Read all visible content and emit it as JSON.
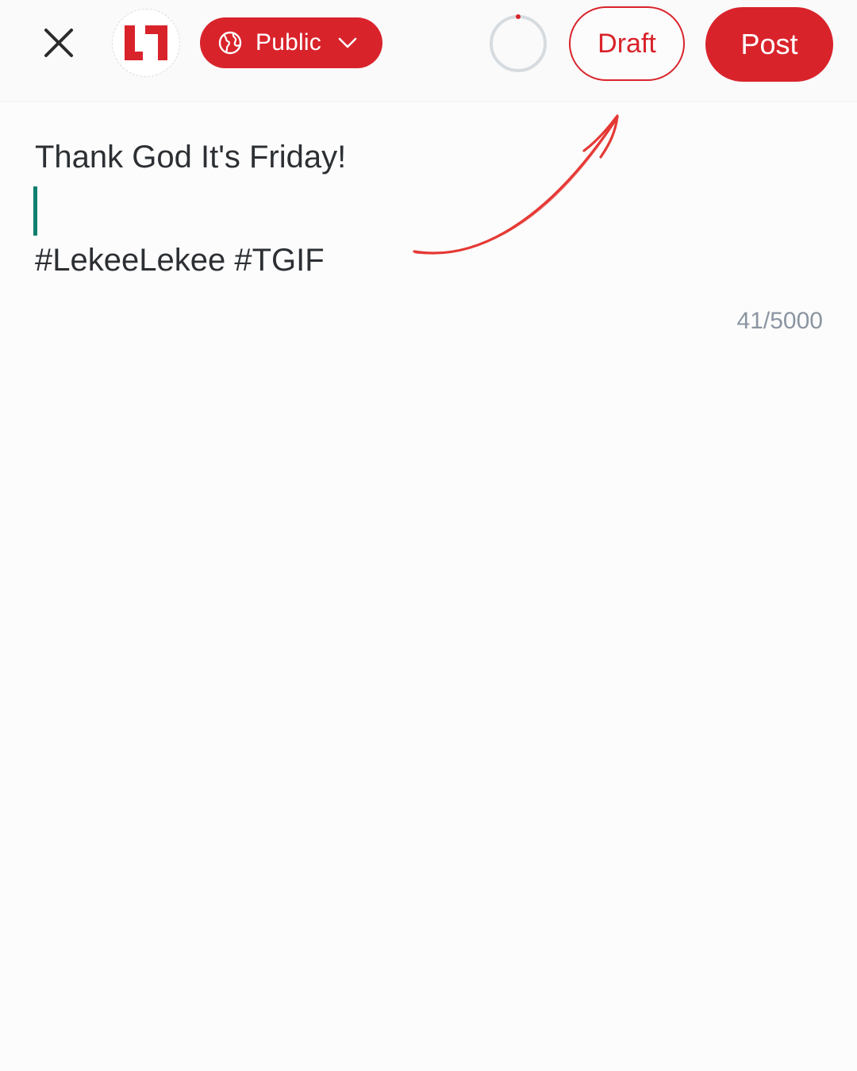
{
  "header": {
    "close_icon": "close-icon",
    "avatar_logo": "L1",
    "visibility": {
      "icon": "globe-icon",
      "label": "Public",
      "dropdown_icon": "chevron-down-icon"
    },
    "progress_icon": "character-progress-ring",
    "draft_label": "Draft",
    "post_label": "Post"
  },
  "composer": {
    "line1": "Thank God It's Friday!",
    "line3": "#LekeeLekee #TGIF",
    "char_counter": "41/5000"
  },
  "annotation": {
    "type": "hand-drawn arrow pointing to Draft button",
    "color": "#e53935"
  },
  "colors": {
    "accent": "#d9232b",
    "caret": "#0f7f6f",
    "counter_text": "#8b95a1",
    "body_text": "#2c2f33"
  }
}
